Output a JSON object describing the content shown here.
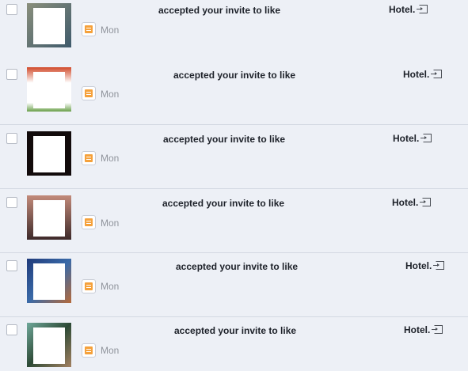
{
  "notifications": [
    {
      "message": "accepted your invite to like",
      "page": "Hotel.",
      "time": "Mon",
      "avatar_colors": [
        "#8a8f7c",
        "#3f5a6b"
      ]
    },
    {
      "message": "accepted your invite to like",
      "page": "Hotel.",
      "time": "Mon",
      "avatar_colors": [
        "#d14a2a",
        "#ffffff"
      ]
    },
    {
      "message": "accepted your invite to like",
      "page": "Hotel.",
      "time": "Mon",
      "avatar_colors": [
        "#120b0b",
        "#3a1d16"
      ]
    },
    {
      "message": "accepted your invite to like",
      "page": "Hotel.",
      "time": "Mon",
      "avatar_colors": [
        "#9c6a5a",
        "#3d2a2a"
      ]
    },
    {
      "message": "accepted your invite to like",
      "page": "Hotel.",
      "time": "Mon",
      "avatar_colors": [
        "#1f3a7a",
        "#b56a3a"
      ]
    },
    {
      "message": "accepted your invite to like",
      "page": "Hotel.",
      "time": "Mon",
      "avatar_colors": [
        "#2d4a36",
        "#a38060"
      ]
    }
  ],
  "colors": {
    "row_bg": "#edf0f6",
    "divider": "#d3d8e2",
    "flag_icon": "#f5a13b",
    "muted_text": "#90949c"
  }
}
